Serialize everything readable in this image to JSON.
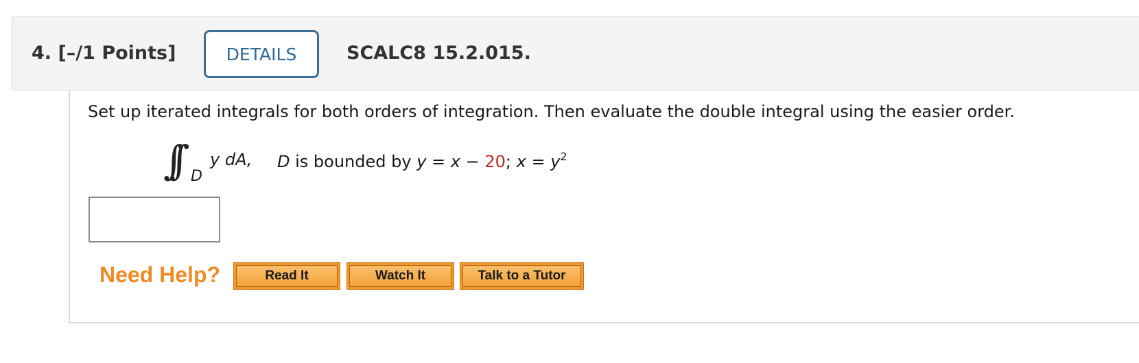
{
  "question": {
    "number_points": "4.  [–/1 Points]",
    "details_label": "DETAILS",
    "source_code": "SCALC8 15.2.015."
  },
  "problem": {
    "instructions": "Set up iterated integrals for both orders of integration. Then evaluate the double integral using the easier order.",
    "integral_symbol": "∫∫",
    "integral_region": "D",
    "integrand": "y dA,",
    "region_text_1": "D",
    "region_text_2": " is bounded by ",
    "eq_y": "y",
    "eq_mid": " = ",
    "eq_x": "x",
    "eq_minus": " − ",
    "eq_constant": "20",
    "eq_sep": "; ",
    "eq_x2": "x",
    "eq_eq2": " = ",
    "eq_y2": "y",
    "eq_exp": "2"
  },
  "answer": {
    "value": "",
    "placeholder": ""
  },
  "help": {
    "label": "Need Help?",
    "buttons": [
      "Read It",
      "Watch It",
      "Talk to a Tutor"
    ]
  },
  "colors": {
    "accent_details": "#2c6a9a",
    "need_help": "#f08a24",
    "highlight_constant": "#c0261b",
    "help_button": "#f39a2f"
  }
}
